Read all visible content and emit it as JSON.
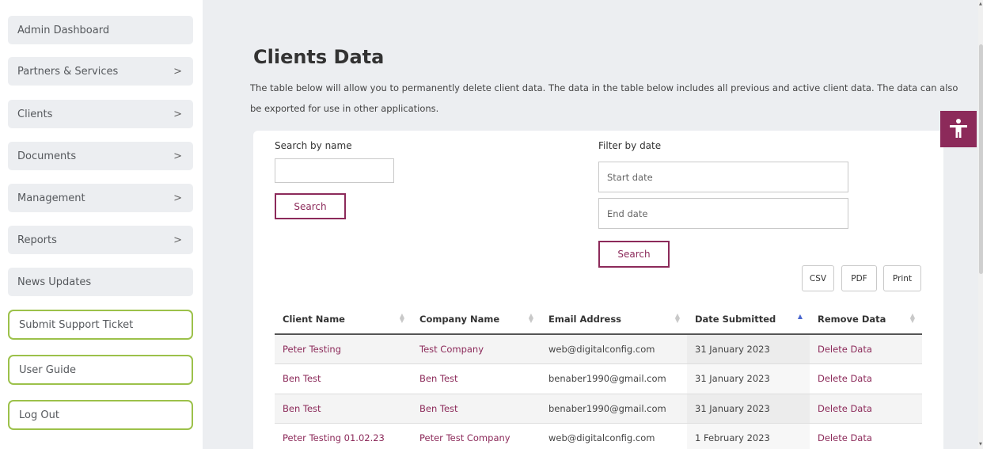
{
  "sidebar": {
    "items": [
      {
        "label": "Admin Dashboard",
        "chevron": false,
        "outlined": false
      },
      {
        "label": "Partners & Services",
        "chevron": true,
        "outlined": false
      },
      {
        "label": "Clients",
        "chevron": true,
        "outlined": false
      },
      {
        "label": "Documents",
        "chevron": true,
        "outlined": false
      },
      {
        "label": "Management",
        "chevron": true,
        "outlined": false
      },
      {
        "label": "Reports",
        "chevron": true,
        "outlined": false
      },
      {
        "label": "News Updates",
        "chevron": false,
        "outlined": false
      },
      {
        "label": "Submit Support Ticket",
        "chevron": false,
        "outlined": true
      },
      {
        "label": "User Guide",
        "chevron": false,
        "outlined": true
      },
      {
        "label": "Log Out",
        "chevron": false,
        "outlined": true
      }
    ],
    "chevron_glyph": ">"
  },
  "page": {
    "title": "Clients Data",
    "description": "The table below will allow you to permanently delete client data. The data in the table below includes all previous and active client data. The data can also be exported for use in other applications."
  },
  "search": {
    "label": "Search by name",
    "value": "",
    "button": "Search"
  },
  "filter": {
    "label": "Filter by date",
    "start_placeholder": "Start date",
    "end_placeholder": "End date",
    "button": "Search"
  },
  "export": {
    "csv": "CSV",
    "pdf": "PDF",
    "print": "Print"
  },
  "table": {
    "columns": [
      "Client Name",
      "Company Name",
      "Email Address",
      "Date Submitted",
      "Remove Data"
    ],
    "sorted_column": "Date Submitted",
    "rows": [
      {
        "client": "Peter Testing",
        "company": "Test Company",
        "email": "web@digitalconfig.com",
        "date": "31 January 2023",
        "action": "Delete Data"
      },
      {
        "client": "Ben Test",
        "company": "Ben Test",
        "email": "benaber1990@gmail.com",
        "date": "31 January 2023",
        "action": "Delete Data"
      },
      {
        "client": "Ben Test",
        "company": "Ben Test",
        "email": "benaber1990@gmail.com",
        "date": "31 January 2023",
        "action": "Delete Data"
      },
      {
        "client": "Peter Testing 01.02.23",
        "company": "Peter Test Company",
        "email": "web@digitalconfig.com",
        "date": "1 February 2023",
        "action": "Delete Data"
      }
    ]
  },
  "colors": {
    "accent": "#8c2a5a",
    "outline_green": "#9cc14a",
    "sort_active": "#4a66cf"
  },
  "icons": {
    "accessibility": "accessibility-icon"
  }
}
